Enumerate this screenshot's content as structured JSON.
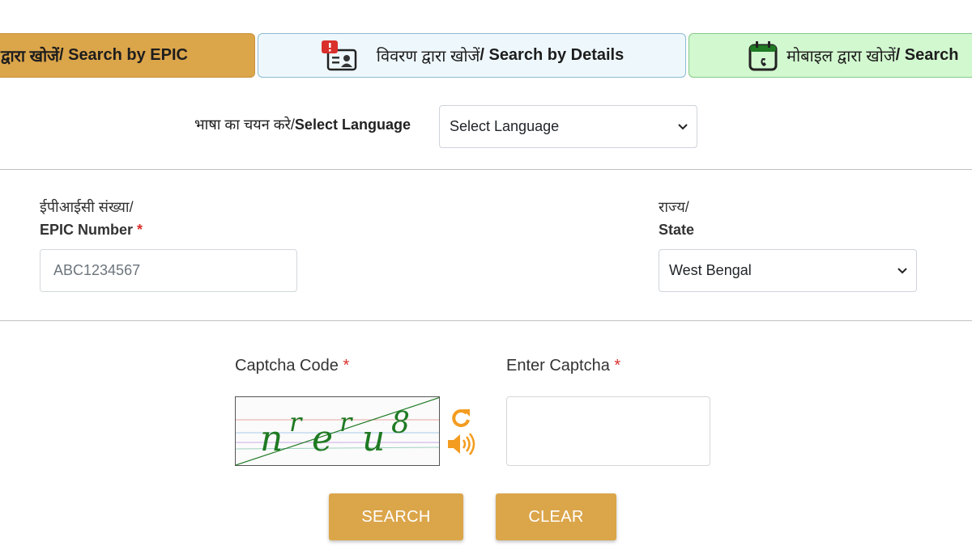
{
  "tabs": {
    "epic": {
      "hi": "द्वारा खोजें",
      "en": " / Search by EPIC"
    },
    "details": {
      "hi": "विवरण द्वारा खोजें",
      "en": "/ Search by Details"
    },
    "mobile": {
      "hi": "मोबाइल द्वारा खोजें",
      "en": " / Search"
    }
  },
  "language": {
    "label_hi": "भाषा का चयन करे/",
    "label_en": "Select Language",
    "selected": "Select Language"
  },
  "form": {
    "epic_label_hi": "ईपीआईसी संख्या/",
    "epic_label_en": "EPIC Number",
    "epic_value": "ABC1234567",
    "state_label_hi": "राज्य/",
    "state_label_en": "State",
    "state_value": "West Bengal",
    "required_mark": "*"
  },
  "captcha": {
    "code_label": "Captcha Code",
    "enter_label": "Enter Captcha",
    "text": "nrerus",
    "glyphs": [
      "n",
      "r",
      "e",
      "r",
      "u",
      "8"
    ]
  },
  "buttons": {
    "search": "SEARCH",
    "clear": "CLEAR"
  },
  "colors": {
    "accent": "#dba54a",
    "icon_orange": "#f39c1f",
    "captcha_green": "#1f7a23",
    "required": "#d9302c"
  }
}
